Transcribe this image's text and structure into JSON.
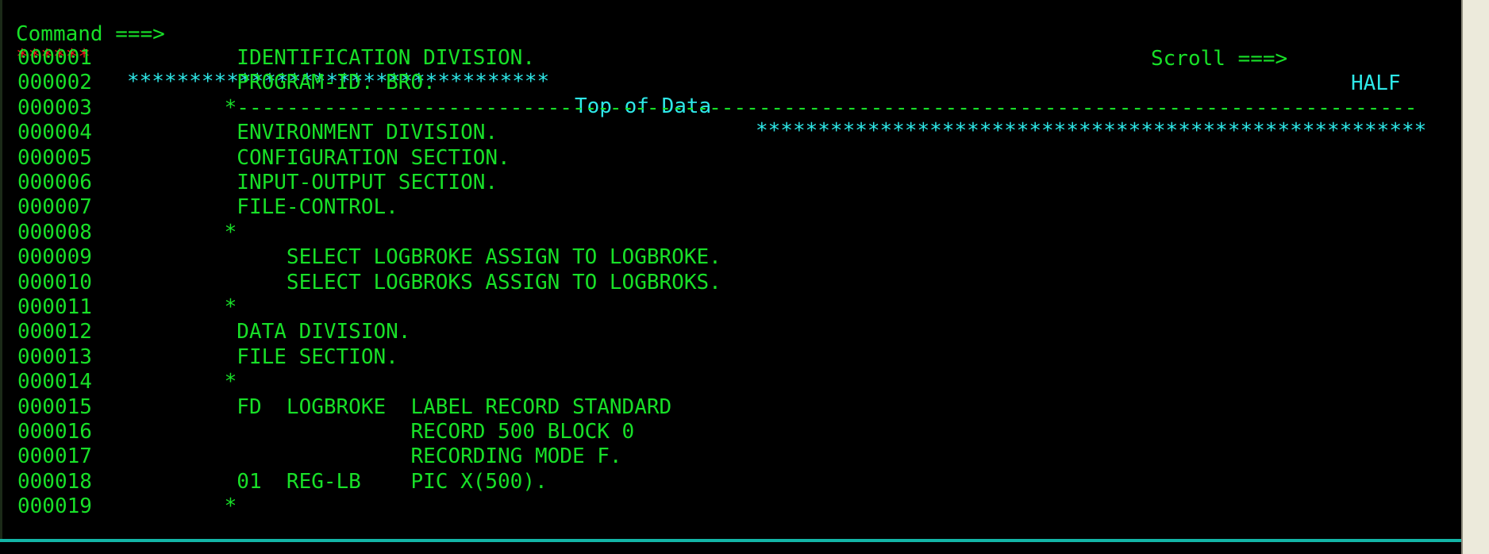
{
  "terminal": {
    "screen_type": "ispf-edit",
    "background": "#000000",
    "colors": {
      "green": "#18e028",
      "cyan": "#2ee8e8",
      "red": "#e81c1c",
      "desktop": "#eceadb",
      "rule": "#13b5a6"
    }
  },
  "header": {
    "command_label": "Command ===>",
    "command_value": "",
    "scroll_label": "Scroll ===>",
    "scroll_value": "HALF"
  },
  "banner": {
    "left_stars": "******",
    "left_fill": "************************",
    "title": "Top of Data",
    "right_fill": "****************************************"
  },
  "lines": [
    {
      "no": "000001",
      "text": "  IDENTIFICATION DIVISION."
    },
    {
      "no": "000002",
      "text": "  PROGRAM-ID. BRO."
    },
    {
      "no": "000003",
      "text": " *------------------------------------------------------------------"
    },
    {
      "no": "000004",
      "text": "  ENVIRONMENT DIVISION."
    },
    {
      "no": "000005",
      "text": "  CONFIGURATION SECTION."
    },
    {
      "no": "000006",
      "text": "  INPUT-OUTPUT SECTION."
    },
    {
      "no": "000007",
      "text": "  FILE-CONTROL."
    },
    {
      "no": "000008",
      "text": " *"
    },
    {
      "no": "000009",
      "text": "      SELECT LOGBROKE ASSIGN TO LOGBROKE."
    },
    {
      "no": "000010",
      "text": "      SELECT LOGBROKS ASSIGN TO LOGBROKS."
    },
    {
      "no": "000011",
      "text": " *"
    },
    {
      "no": "000012",
      "text": "  DATA DIVISION."
    },
    {
      "no": "000013",
      "text": "  FILE SECTION."
    },
    {
      "no": "000014",
      "text": " *"
    },
    {
      "no": "000015",
      "text": "  FD  LOGBROKE  LABEL RECORD STANDARD"
    },
    {
      "no": "000016",
      "text": "                RECORD 500 BLOCK 0"
    },
    {
      "no": "000017",
      "text": "                RECORDING MODE F."
    },
    {
      "no": "000018",
      "text": "  01  REG-LB    PIC X(500)."
    },
    {
      "no": "000019",
      "text": " *"
    }
  ]
}
